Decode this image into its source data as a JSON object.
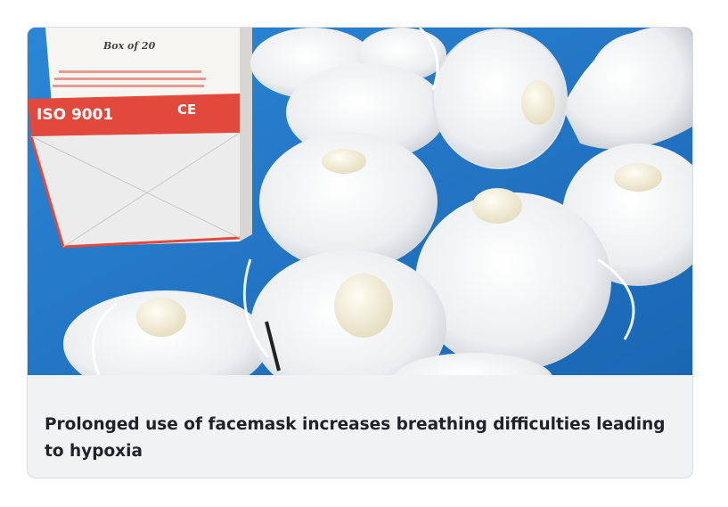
{
  "card": {
    "caption": "Prolonged use of facemask increases breathing difficulties leading to hypoxia"
  },
  "image": {
    "box_count_label": "Box of 20",
    "box_standard_label": "ISO 9001",
    "box_mark_label": "CE",
    "colors": {
      "background": "#1e74c6",
      "box_red": "#e2483b",
      "mask_white": "#f3f4f5",
      "valve": "#f6f1df"
    }
  }
}
